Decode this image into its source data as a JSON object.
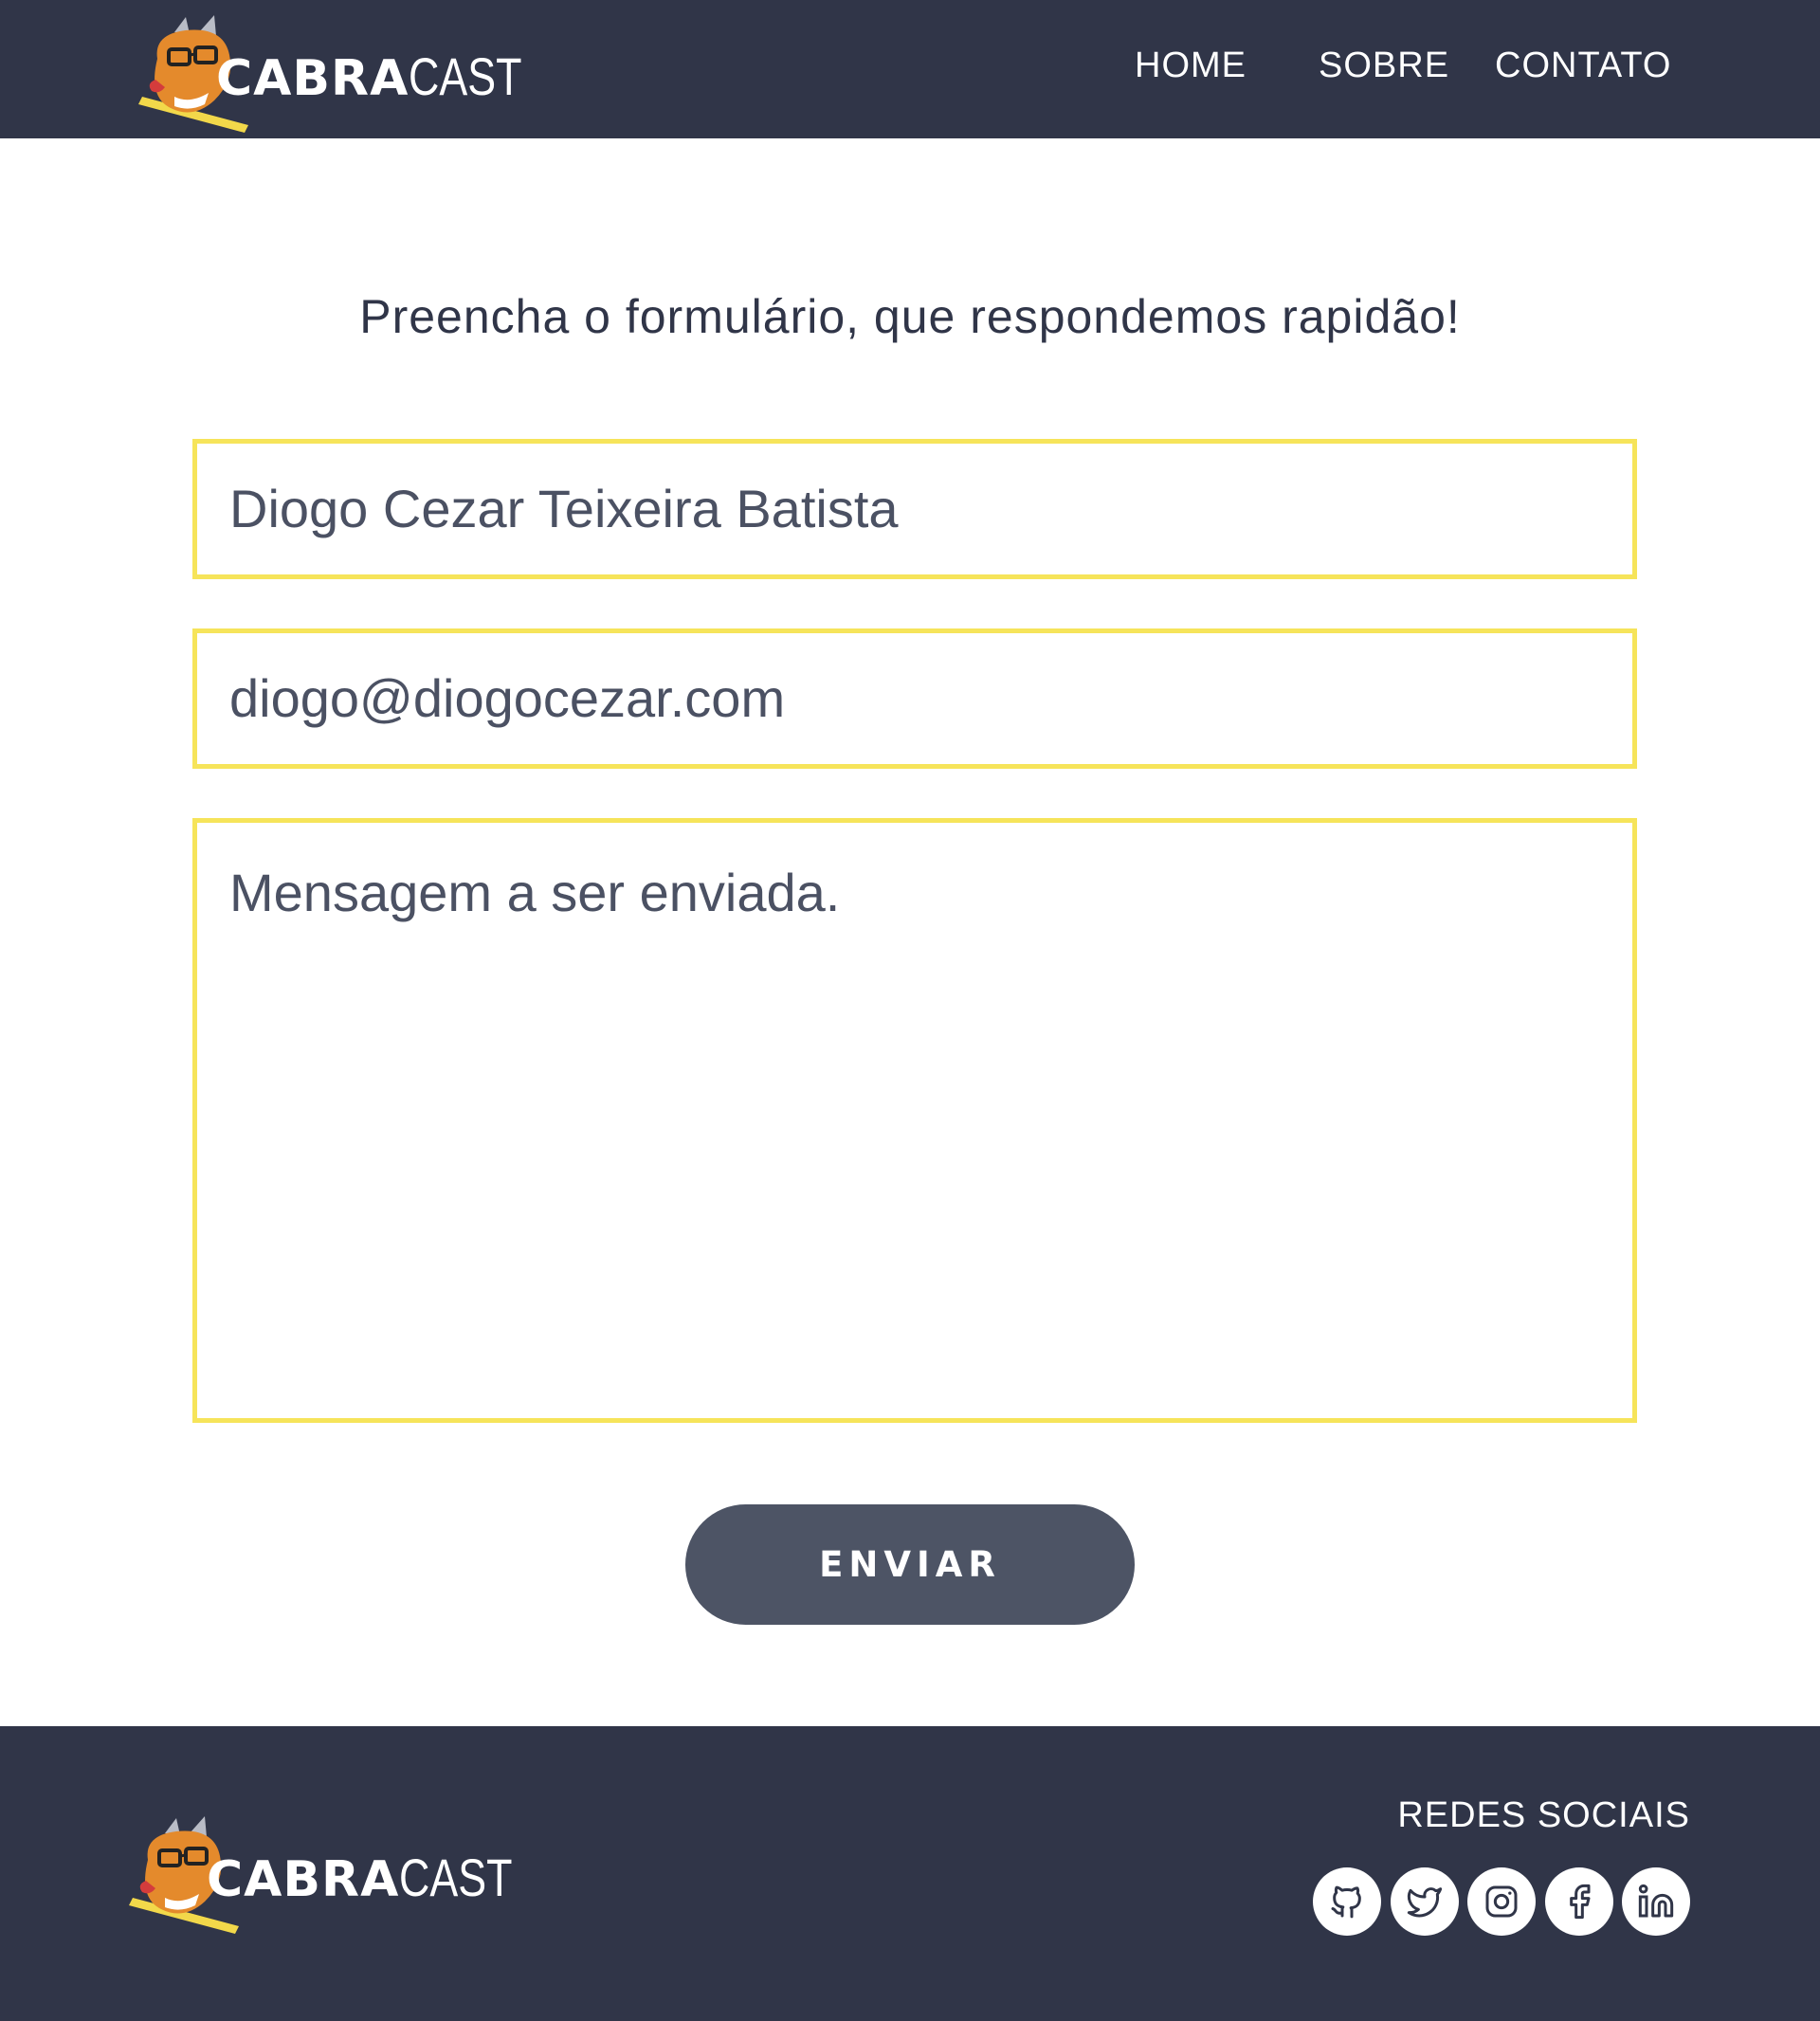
{
  "brand": {
    "word1": "CABRA",
    "word2": "CAST"
  },
  "nav": {
    "home": "HOME",
    "sobre": "SOBRE",
    "contato": "CONTATO"
  },
  "form": {
    "heading": "Preencha o formulário, que respondemos rapidão!",
    "name_value": "Diogo Cezar Teixeira Batista",
    "email_value": "diogo@diogocezar.com",
    "message_placeholder": "Mensagem a ser enviada.",
    "submit_label": "ENVIAR"
  },
  "footer": {
    "social_title": "REDES SOCIAIS",
    "social_icons": [
      "github-icon",
      "twitter-icon",
      "instagram-icon",
      "facebook-icon",
      "linkedin-icon"
    ]
  },
  "colors": {
    "header_bg": "#303548",
    "field_border": "#f6e45a",
    "button_bg": "#4d5465",
    "text_dark": "#303548"
  }
}
